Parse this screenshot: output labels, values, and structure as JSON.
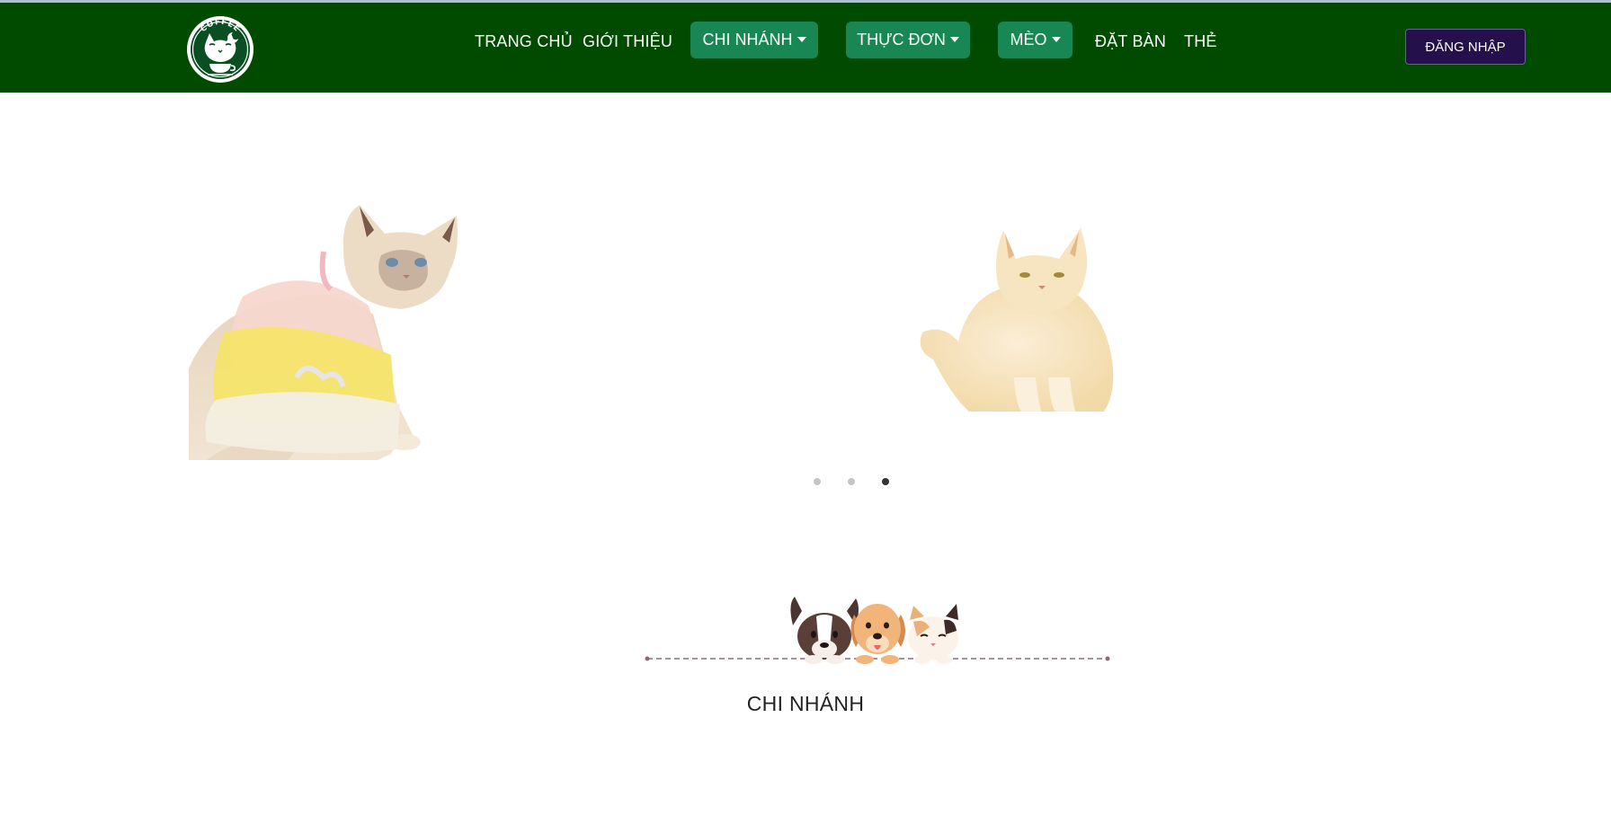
{
  "brand": {
    "logo_icon": "coffee-cat-logo",
    "logo_text": "COFFEE"
  },
  "nav": {
    "home": "TRANG CHỦ",
    "about": "GIỚI THIỆU",
    "branches": "CHI NHÁNH",
    "menu": "THỰC ĐƠN",
    "cats": "MÈO",
    "booking": "ĐẶT BÀN",
    "card": "THẺ",
    "login": "ĐĂNG NHẬP"
  },
  "carousel": {
    "slides": [
      "cat-in-yellow-dress",
      "white-fluffy-cat"
    ],
    "indicator_count": 3,
    "active_indicator": 3
  },
  "section": {
    "title": "CHI NHÁNH",
    "divider_icon": "dogs-and-cat-peeking-icon"
  },
  "colors": {
    "navbar": "#004b00",
    "pill": "#198754",
    "login": "#24104b",
    "divider": "#8a6a7a"
  }
}
